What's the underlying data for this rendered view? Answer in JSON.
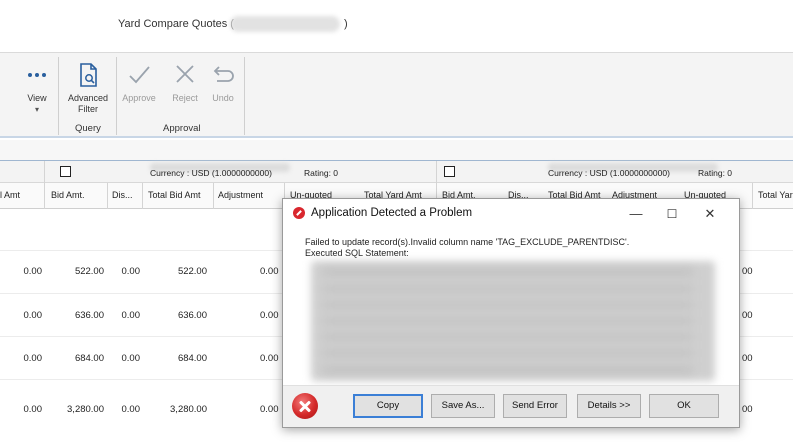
{
  "window": {
    "title_prefix": "Yard Compare Quotes (",
    "title_suffix": ")"
  },
  "ribbon": {
    "view_label": "View",
    "advanced_filter_label_1": "Advanced",
    "advanced_filter_label_2": "Filter",
    "approve_label": "Approve",
    "reject_label": "Reject",
    "undo_label": "Undo",
    "group_query": "Query",
    "group_approval": "Approval"
  },
  "grid": {
    "vendor_blocks": [
      {
        "currency": "Currency : USD (1.0000000000)",
        "rating": "Rating: 0"
      },
      {
        "currency": "Currency : USD (1.0000000000)",
        "rating": "Rating: 0"
      }
    ],
    "columns_left": [
      "l Amt",
      "Bid Amt.",
      "Dis...",
      "Total Bid Amt",
      "Adjustment",
      "Un-quoted",
      "Total Yard Amt"
    ],
    "columns_right": [
      "Bid Amt.",
      "Dis...",
      "Total Bid Amt",
      "Adjustment",
      "Un-quoted",
      "Total Yar"
    ],
    "rows": [
      {
        "amt": "0.00",
        "bid": "522.00",
        "disc": "0.00",
        "total": "522.00",
        "adj": "0.00"
      },
      {
        "amt": "0.00",
        "bid": "636.00",
        "disc": "0.00",
        "total": "636.00",
        "adj": "0.00"
      },
      {
        "amt": "0.00",
        "bid": "684.00",
        "disc": "0.00",
        "total": "684.00",
        "adj": "0.00"
      },
      {
        "amt": "0.00",
        "bid": "3,280.00",
        "disc": "0.00",
        "total": "3,280.00",
        "adj": "0.00"
      }
    ],
    "right_clip": "00"
  },
  "dialog": {
    "title": "Application Detected a Problem",
    "message_line_1": "Failed to update record(s).Invalid column name 'TAG_EXCLUDE_PARENTDISC'.",
    "message_line_2": "Executed SQL Statement:",
    "minimize": "—",
    "maximize": "☐",
    "close": "✕",
    "buttons": {
      "copy": "Copy",
      "save_as": "Save As...",
      "send_error": "Send Error",
      "details": "Details >>",
      "ok": "OK"
    }
  },
  "colors": {
    "error_red": "#d42a2a",
    "default_button_border": "#3b7fd6"
  }
}
